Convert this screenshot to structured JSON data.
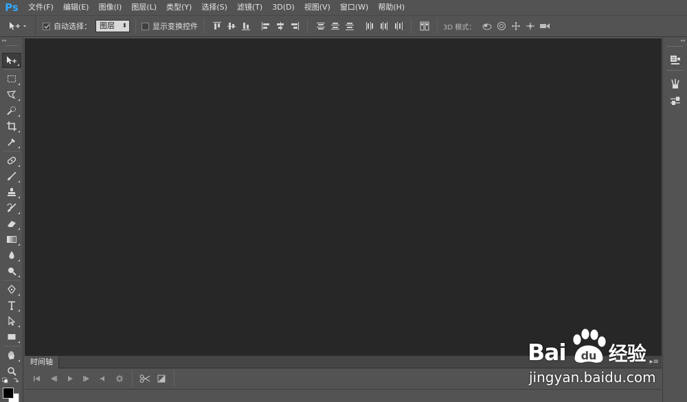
{
  "app": {
    "logo": "Ps"
  },
  "menu": [
    "文件(F)",
    "编辑(E)",
    "图像(I)",
    "图层(L)",
    "类型(Y)",
    "选择(S)",
    "滤镜(T)",
    "3D(D)",
    "视图(V)",
    "窗口(W)",
    "帮助(H)"
  ],
  "options": {
    "auto_select_label": "自动选择：",
    "auto_select_checked": true,
    "auto_select_value": "图层",
    "show_transform_label": "显示变换控件",
    "show_transform_checked": false,
    "mode_3d_label": "3D 模式："
  },
  "timeline": {
    "tab_label": "时间轴"
  },
  "watermark": {
    "brand": "Bai",
    "brand_suffix": "经验",
    "url": "jingyan.baidu.com",
    "paw_letters": "du"
  },
  "colors": {
    "foreground": "#000000",
    "background": "#ffffff",
    "logo": "#31a8ff",
    "canvas": "#272727"
  }
}
